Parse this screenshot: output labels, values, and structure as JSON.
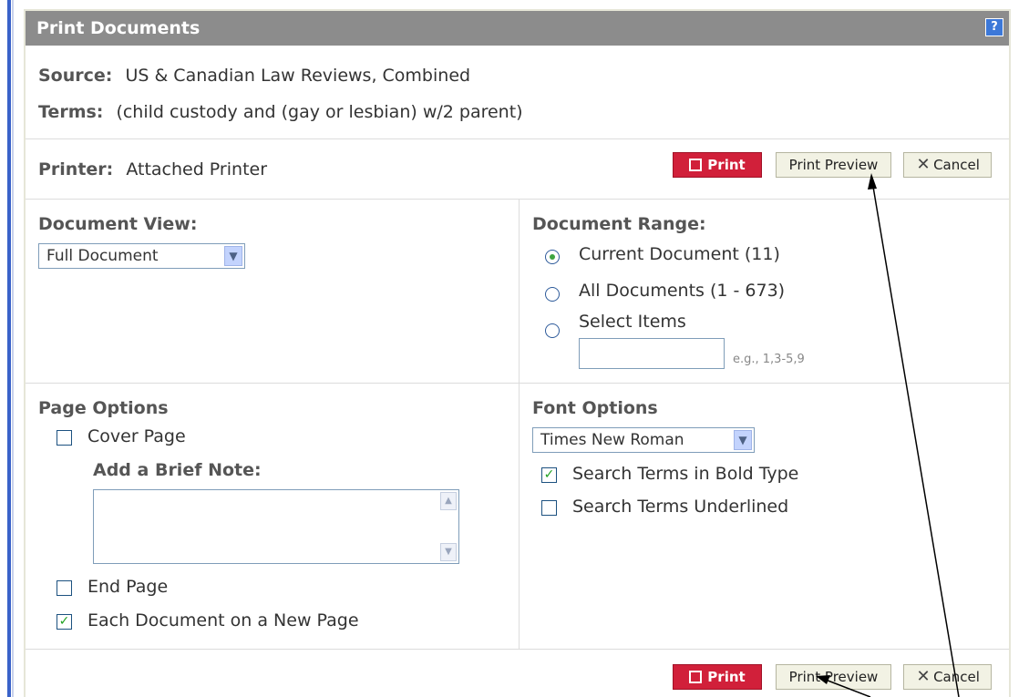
{
  "dialog": {
    "title": "Print Documents",
    "help_label": "?"
  },
  "info": {
    "source_label": "Source:",
    "source_value": "US & Canadian Law Reviews, Combined",
    "terms_label": "Terms:",
    "terms_value": "(child custody and (gay or lesbian) w/2 parent)"
  },
  "printer": {
    "label": "Printer:",
    "value": "Attached Printer"
  },
  "buttons": {
    "print": "Print",
    "print_preview": "Print Preview",
    "cancel": "Cancel"
  },
  "document_view": {
    "heading": "Document View:",
    "selected": "Full Document"
  },
  "document_range": {
    "heading": "Document Range:",
    "options": [
      {
        "label": "Current Document (11)",
        "selected": true
      },
      {
        "label": "All Documents (1 - 673)",
        "selected": false
      },
      {
        "label": "Select Items",
        "selected": false
      }
    ],
    "items_placeholder": "",
    "items_hint": "e.g., 1,3-5,9"
  },
  "page_options": {
    "heading": "Page Options",
    "cover_page": {
      "label": "Cover Page",
      "checked": false
    },
    "brief_note_label": "Add a Brief Note:",
    "end_page": {
      "label": "End Page",
      "checked": false
    },
    "new_page": {
      "label": "Each Document on a New Page",
      "checked": true
    }
  },
  "font_options": {
    "heading": "Font Options",
    "selected_font": "Times New Roman",
    "bold_terms": {
      "label": "Search Terms in Bold Type",
      "checked": true
    },
    "underline_terms": {
      "label": "Search Terms Underlined",
      "checked": false
    }
  },
  "colors": {
    "title_bar": "#8c8c8c",
    "print_button": "#d1203a",
    "accent_blue": "#3a62c9"
  }
}
